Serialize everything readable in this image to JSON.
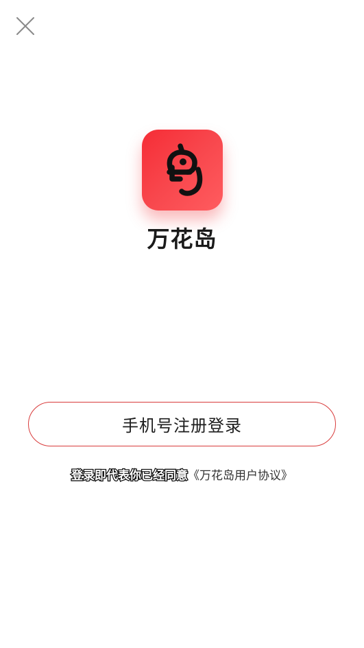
{
  "header": {
    "close_icon": "close-icon"
  },
  "app": {
    "icon": "app-logo-icon",
    "name": "万花岛",
    "brand_color": "#f62d36"
  },
  "login": {
    "register_button_label": "手机号注册登录",
    "button_border_color": "#d83a3a"
  },
  "agreement": {
    "prefix": "登录即代表你已经同意",
    "link_text": "《万花岛用户协议》"
  }
}
